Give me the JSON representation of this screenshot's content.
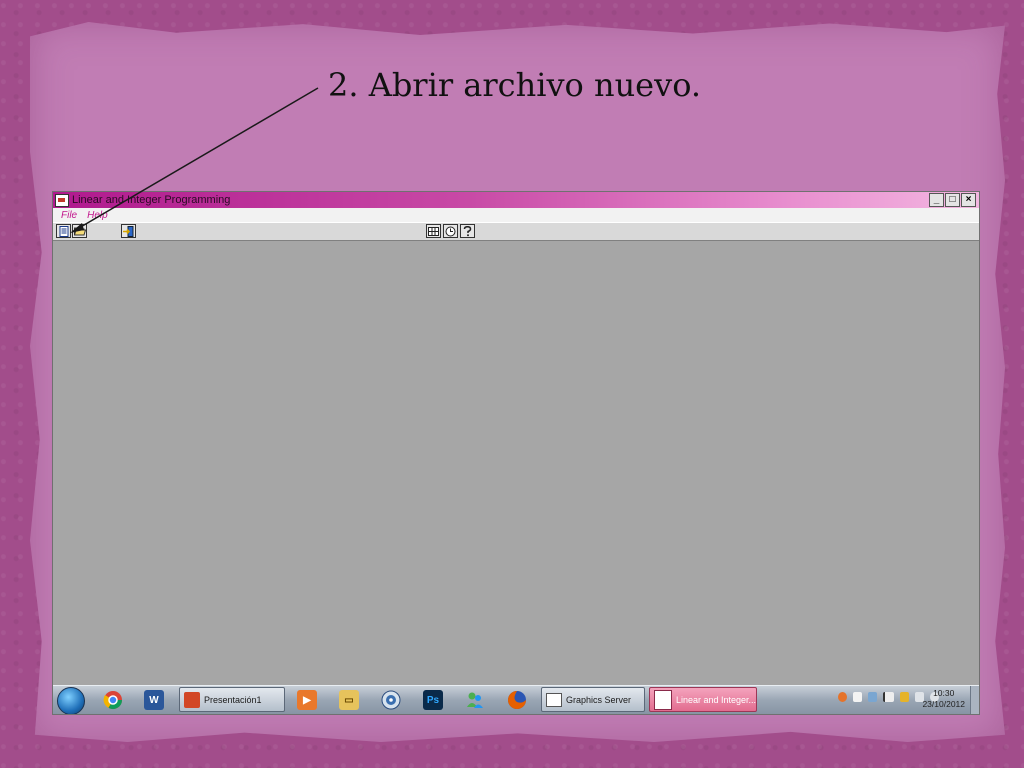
{
  "slide": {
    "heading": "2. Abrir archivo nuevo."
  },
  "window": {
    "title": "Linear and Integer Programming",
    "controls": {
      "minimize": "_",
      "maximize": "□",
      "close": "×"
    },
    "menu": [
      "File",
      "Help"
    ],
    "toolbar": [
      {
        "name": "new-file-icon",
        "hint": "new"
      },
      {
        "name": "open-file-icon",
        "hint": "open"
      },
      {
        "name": "exit-icon",
        "hint": "exit"
      },
      {
        "name": "grid-icon",
        "hint": "grid"
      },
      {
        "name": "clock-icon",
        "hint": "clock"
      },
      {
        "name": "help-icon",
        "hint": "help"
      }
    ]
  },
  "taskbar": {
    "pinned": [
      "chrome-icon",
      "word-icon",
      "media-player-icon",
      "explorer-icon",
      "dvd-icon",
      "photoshop-icon",
      "messenger-icon",
      "firefox-icon"
    ],
    "tasks": [
      {
        "label": "Presentación1"
      },
      {
        "label": "Graphics Server"
      },
      {
        "label": "Linear and Integer..."
      }
    ],
    "clock": {
      "time": "10:30",
      "date": "23/10/2012"
    }
  },
  "colors": {
    "background": "#a24d8b",
    "paper": "#c17db4",
    "titlebar_start": "#b01a8e",
    "workarea": "#a6a6a6",
    "menu_text": "#c2188d"
  }
}
